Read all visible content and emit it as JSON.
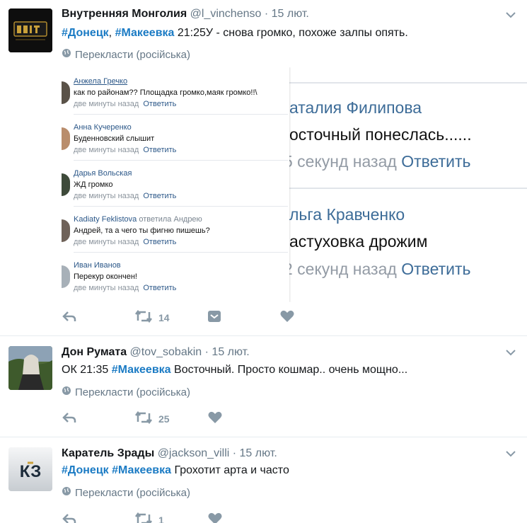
{
  "tweets": [
    {
      "author": "Внутренняя Монголия",
      "handle": "@l_vinchenso",
      "dot": "·",
      "date": "15 лют.",
      "text_tag1": "#Донецк",
      "text_sep": ", ",
      "text_tag2": "#Макеевка",
      "text_rest": " 21:25У  - снова громко, похоже залпы опять.",
      "translate": "Перекласти (російська)",
      "retweets": "14",
      "likes": ""
    },
    {
      "author": "Дон Румата",
      "handle": "@tov_sobakin",
      "dot": "·",
      "date": "15 лют.",
      "text_pre": "ОК 21:35 ",
      "text_tag": "#Макеевка",
      "text_rest": " Восточный. Просто кошмар.. очень мощно...",
      "translate": "Перекласти (російська)",
      "retweets": "25"
    },
    {
      "author": "Каратель Зрады",
      "handle": "@jackson_villi",
      "dot": "·",
      "date": "15 лют.",
      "text_tag1": "#Донецк",
      "text_sep": " ",
      "text_tag2": "#Макеевка",
      "text_rest": " Грохотит арта и часто",
      "translate": "Перекласти (російська)",
      "retweets": "1",
      "avatar_text": "КЗ"
    }
  ],
  "embed": {
    "comments": [
      {
        "name": "Анжела Гречко",
        "sub": "",
        "text": "как по районам?? Площадка громко,маяк громко!!\\",
        "time": "две минуты назад",
        "reply": "Ответить"
      },
      {
        "name": "Анна Кучеренко",
        "sub": "",
        "text": "Буденновский слышит",
        "time": "две минуты назад",
        "reply": "Ответить"
      },
      {
        "name": "Дарья Вольская",
        "sub": "",
        "text": "ЖД громко",
        "time": "две минуты назад",
        "reply": "Ответить"
      },
      {
        "name": "Kadiaty Feklistova",
        "sub": " ответила Андрею",
        "text": "Андрей, та а чего ты фигню пишешь?",
        "time": "две минуты назад",
        "reply": "Ответить"
      },
      {
        "name": "Иван Иванов",
        "sub": "",
        "text": "Перекур окончен!",
        "time": "две минуты назад",
        "reply": "Ответить"
      }
    ],
    "background": [
      {
        "name": "аталия Филипова",
        "msg": "осточный понеслась......",
        "time": "5 секунд назад",
        "reply": "Ответить"
      },
      {
        "name": "льга Кравченко",
        "msg": "астуховка дрожим",
        "time": "2 секунд назад",
        "reply": "Ответить"
      }
    ]
  },
  "icons": {
    "reply": "reply-arrow-icon",
    "retweet": "retweet-icon",
    "like": "heart-icon",
    "dm": "direct-message-icon",
    "globe": "globe-icon",
    "caret": "chevron-down-icon"
  },
  "colors": {
    "hashtag": "#1b7bc4",
    "muted": "#657786",
    "action": "#8899a6",
    "vk_link": "#2b5788"
  }
}
